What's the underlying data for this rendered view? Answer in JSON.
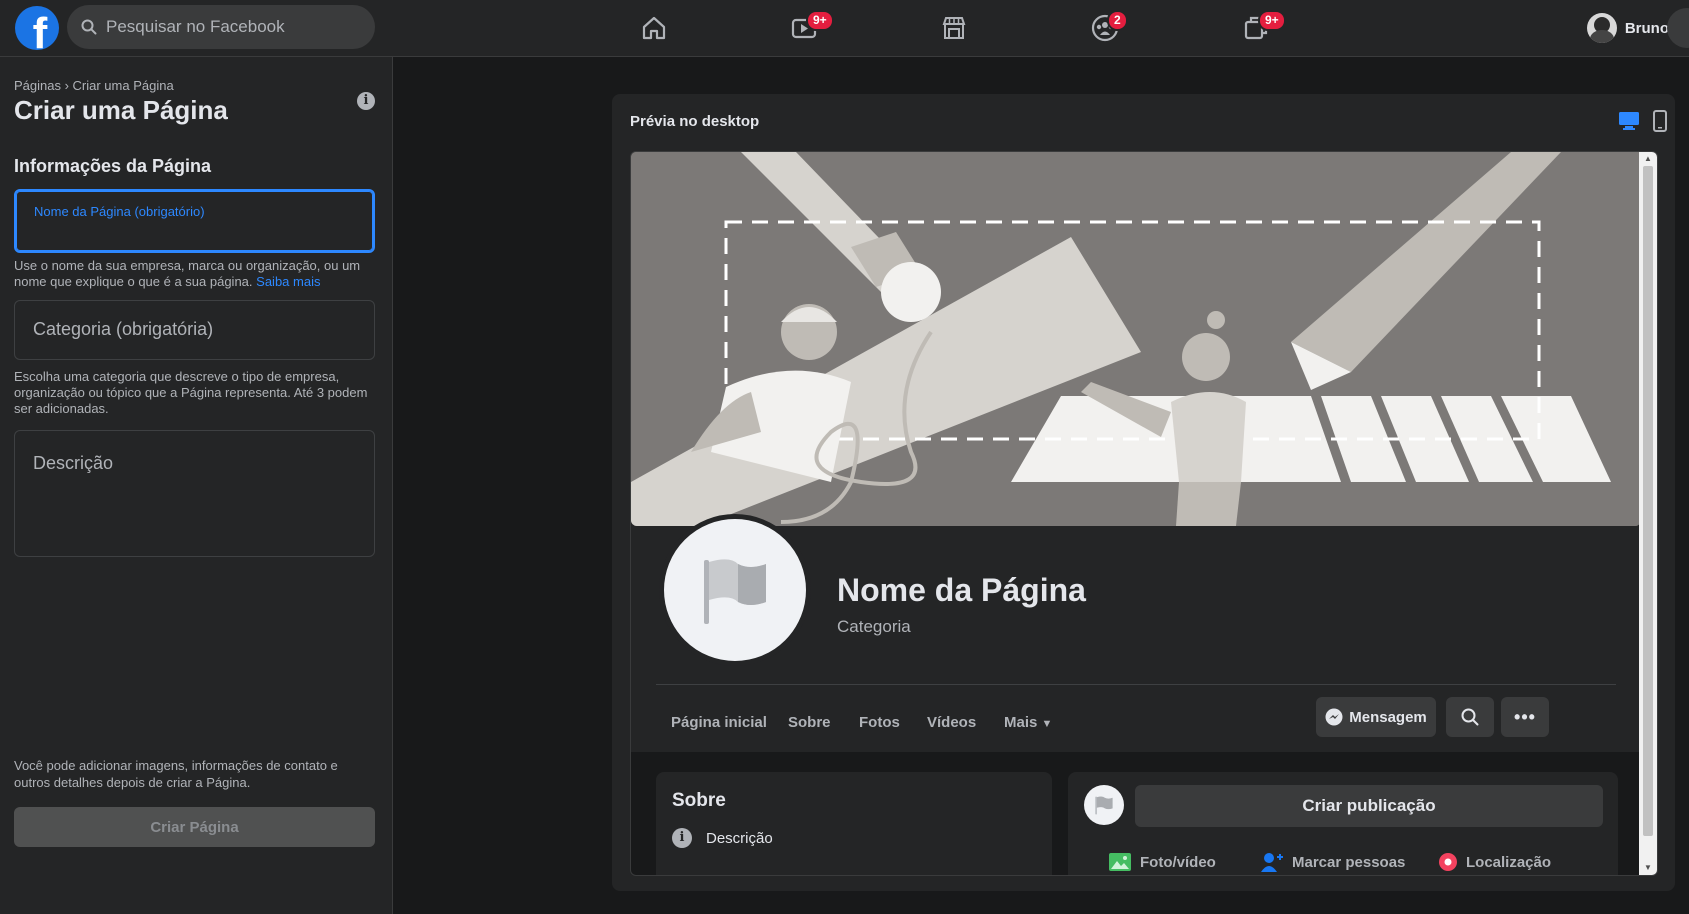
{
  "topbar": {
    "search_placeholder": "Pesquisar no Facebook",
    "badges": {
      "watch": "9+",
      "groups": "2",
      "gaming": "9+"
    },
    "profile_name": "Bruno"
  },
  "sidebar": {
    "breadcrumb": "Páginas › Criar uma Página",
    "title": "Criar uma Página",
    "section_title": "Informações da Página",
    "name_field_label": "Nome da Página (obrigatório)",
    "name_helper": "Use o nome da sua empresa, marca ou organização, ou um nome que explique o que é a sua página.",
    "name_helper_link": "Saiba mais",
    "category_field_label": "Categoria (obrigatória)",
    "category_helper": "Escolha uma categoria que descreve o tipo de empresa, organização ou tópico que a Página representa. Até 3 podem ser adicionadas.",
    "description_field_label": "Descrição",
    "footer_note": "Você pode adicionar imagens, informações de contato e outros detalhes depois de criar a Página.",
    "create_button": "Criar Página"
  },
  "preview": {
    "title": "Prévia no desktop",
    "page_name": "Nome da Página",
    "page_category": "Categoria",
    "tabs": [
      "Página inicial",
      "Sobre",
      "Fotos",
      "Vídeos",
      "Mais"
    ],
    "message_button": "Mensagem",
    "about_title": "Sobre",
    "about_description": "Descrição",
    "create_post": "Criar publicação",
    "post_actions": [
      "Foto/vídeo",
      "Marcar pessoas",
      "Localização"
    ]
  },
  "colors": {
    "accent": "#2d88ff",
    "badge": "#e41e3f",
    "background": "#18191a",
    "surface": "#242526"
  }
}
